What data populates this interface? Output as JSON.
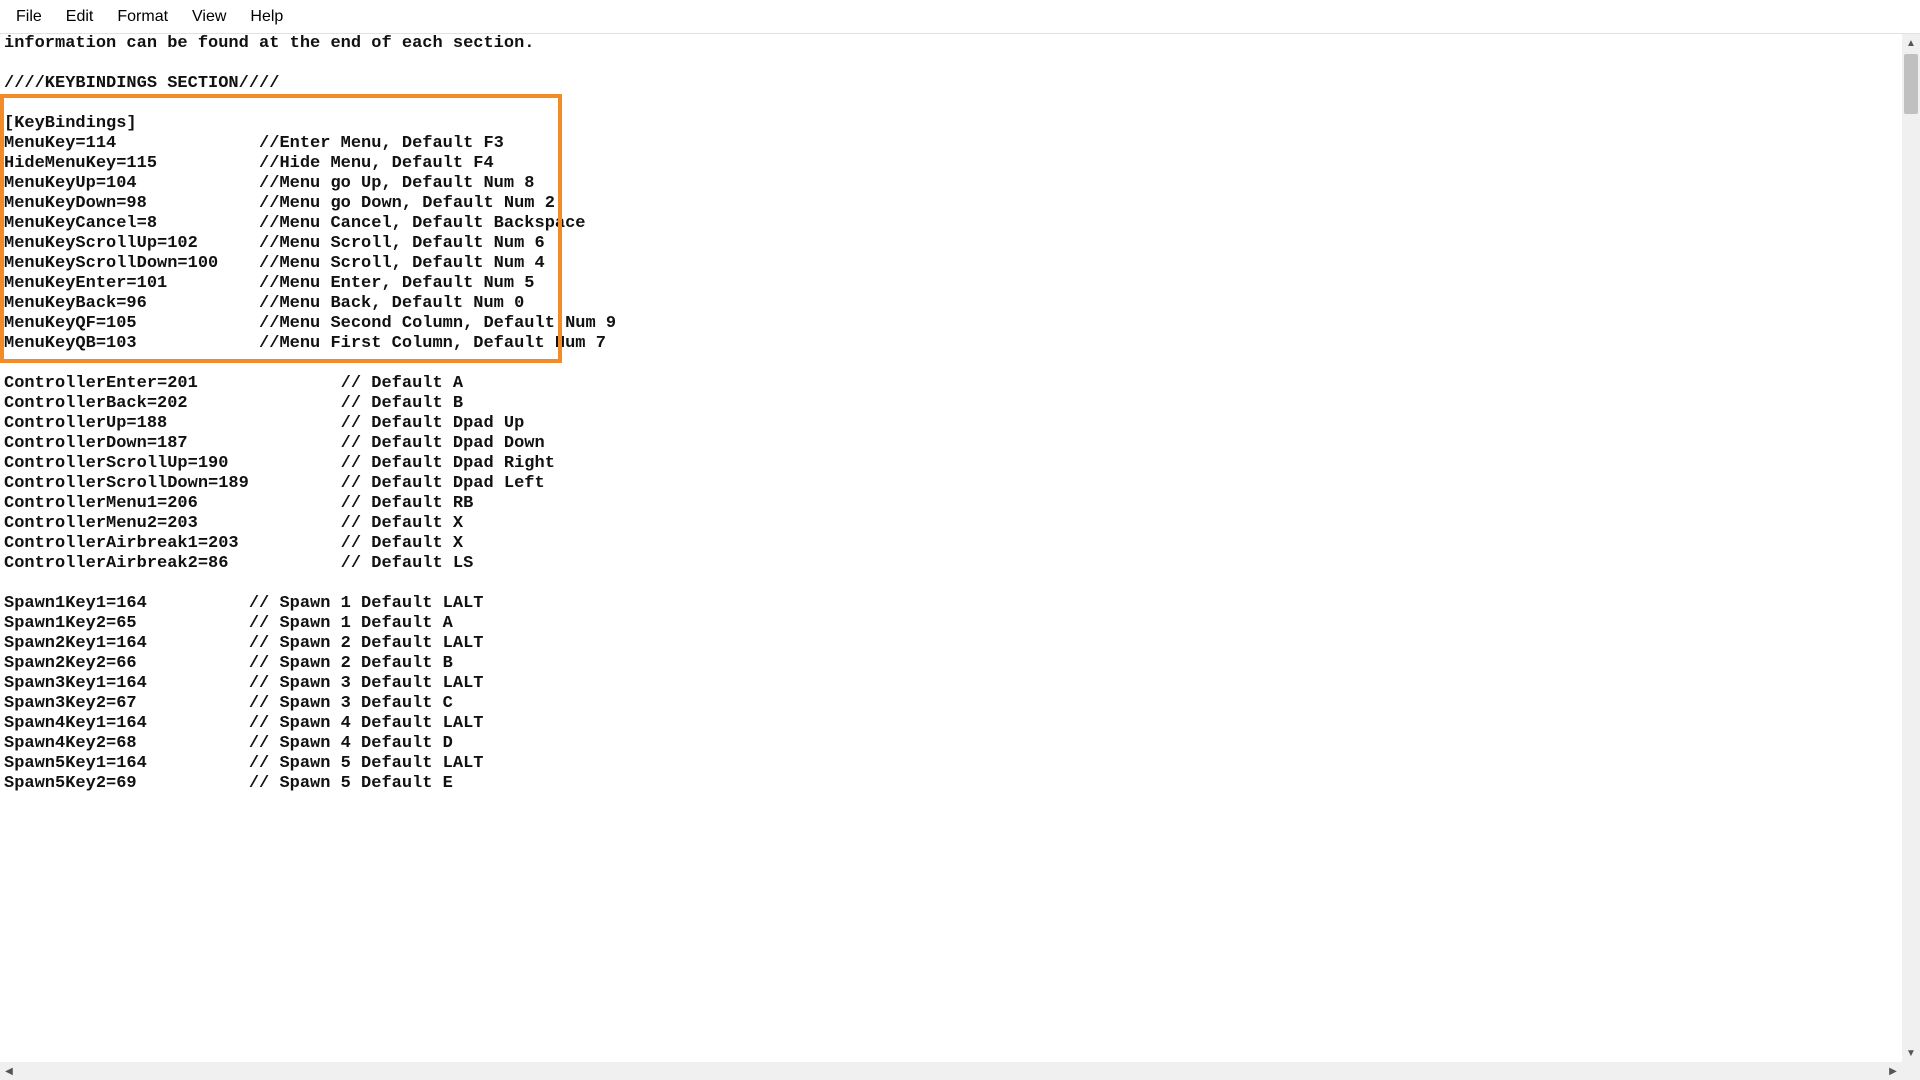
{
  "menubar": {
    "items": [
      "File",
      "Edit",
      "Format",
      "View",
      "Help"
    ]
  },
  "highlight": {
    "color": "#f28c28"
  },
  "content": {
    "top_line": "information can be found at the end of each section.",
    "section_header": "////KEYBINDINGS SECTION////",
    "group_header": "[KeyBindings]",
    "keybindings": [
      {
        "key": "MenuKey=114",
        "pad": 25,
        "comment": "//Enter Menu, Default F3"
      },
      {
        "key": "HideMenuKey=115",
        "pad": 25,
        "comment": "//Hide Menu, Default F4"
      },
      {
        "key": "MenuKeyUp=104",
        "pad": 25,
        "comment": "//Menu go Up, Default Num 8"
      },
      {
        "key": "MenuKeyDown=98",
        "pad": 25,
        "comment": "//Menu go Down, Default Num 2"
      },
      {
        "key": "MenuKeyCancel=8",
        "pad": 25,
        "comment": "//Menu Cancel, Default Backspace"
      },
      {
        "key": "MenuKeyScrollUp=102",
        "pad": 25,
        "comment": "//Menu Scroll, Default Num 6"
      },
      {
        "key": "MenuKeyScrollDown=100",
        "pad": 25,
        "comment": "//Menu Scroll, Default Num 4"
      },
      {
        "key": "MenuKeyEnter=101",
        "pad": 25,
        "comment": "//Menu Enter, Default Num 5"
      },
      {
        "key": "MenuKeyBack=96",
        "pad": 25,
        "comment": "//Menu Back, Default Num 0"
      },
      {
        "key": "MenuKeyQF=105",
        "pad": 25,
        "comment": "//Menu Second Column, Default Num 9"
      },
      {
        "key": "MenuKeyQB=103",
        "pad": 25,
        "comment": "//Menu First Column, Default Num 7"
      }
    ],
    "controller": [
      {
        "key": "ControllerEnter=201",
        "pad": 33,
        "comment": "// Default A"
      },
      {
        "key": "ControllerBack=202",
        "pad": 33,
        "comment": "// Default B"
      },
      {
        "key": "ControllerUp=188",
        "pad": 33,
        "comment": "// Default Dpad Up"
      },
      {
        "key": "ControllerDown=187",
        "pad": 33,
        "comment": "// Default Dpad Down"
      },
      {
        "key": "ControllerScrollUp=190",
        "pad": 33,
        "comment": "// Default Dpad Right"
      },
      {
        "key": "ControllerScrollDown=189",
        "pad": 33,
        "comment": "// Default Dpad Left"
      },
      {
        "key": "ControllerMenu1=206",
        "pad": 33,
        "comment": "// Default RB"
      },
      {
        "key": "ControllerMenu2=203",
        "pad": 33,
        "comment": "// Default X"
      },
      {
        "key": "ControllerAirbreak1=203",
        "pad": 33,
        "comment": "// Default X"
      },
      {
        "key": "ControllerAirbreak2=86",
        "pad": 33,
        "comment": "// Default LS"
      }
    ],
    "spawn": [
      {
        "key": "Spawn1Key1=164",
        "pad": 24,
        "comment": "// Spawn 1 Default LALT"
      },
      {
        "key": "Spawn1Key2=65",
        "pad": 24,
        "comment": "// Spawn 1 Default A"
      },
      {
        "key": "Spawn2Key1=164",
        "pad": 24,
        "comment": "// Spawn 2 Default LALT"
      },
      {
        "key": "Spawn2Key2=66",
        "pad": 24,
        "comment": "// Spawn 2 Default B"
      },
      {
        "key": "Spawn3Key1=164",
        "pad": 24,
        "comment": "// Spawn 3 Default LALT"
      },
      {
        "key": "Spawn3Key2=67",
        "pad": 24,
        "comment": "// Spawn 3 Default C"
      },
      {
        "key": "Spawn4Key1=164",
        "pad": 24,
        "comment": "// Spawn 4 Default LALT"
      },
      {
        "key": "Spawn4Key2=68",
        "pad": 24,
        "comment": "// Spawn 4 Default D"
      },
      {
        "key": "Spawn5Key1=164",
        "pad": 24,
        "comment": "// Spawn 5 Default LALT"
      },
      {
        "key": "Spawn5Key2=69",
        "pad": 24,
        "comment": "// Spawn 5 Default E"
      }
    ]
  }
}
